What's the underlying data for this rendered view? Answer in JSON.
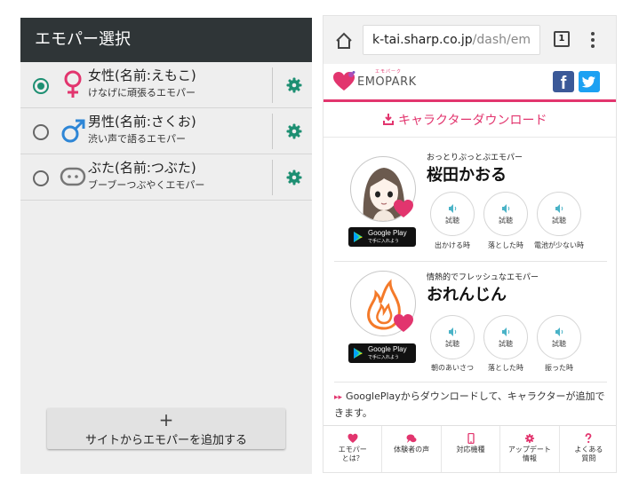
{
  "left": {
    "header_title": "エモパー選択",
    "items": [
      {
        "name": "女性(名前:えもこ)",
        "desc": "けなげに頑張るエモパー",
        "selected": true,
        "icon": "female-icon",
        "icon_color": "#e2356e"
      },
      {
        "name": "男性(名前:さくお)",
        "desc": "渋い声で語るエモパー",
        "selected": false,
        "icon": "male-icon",
        "icon_color": "#2e86d6"
      },
      {
        "name": "ぶた(名前:つぶた)",
        "desc": "ブーブーつぶやくエモパー",
        "selected": false,
        "icon": "pig-icon",
        "icon_color": "#777777"
      }
    ],
    "gear_icon": "gear-icon",
    "add_button_plus": "+",
    "add_button_label": "サイトからエモパーを追加する",
    "accent_color": "#1d8f72"
  },
  "browser": {
    "url_main": "k-tai.sharp.co.jp",
    "url_rest": "/dash/em",
    "tab_count": "1",
    "home_icon": "home-icon",
    "menu_icon": "overflow-menu-icon"
  },
  "site": {
    "logo_text": "EMOPARK",
    "logo_ruby": "エモパーク",
    "facebook_glyph": "f",
    "download_label": "キャラクターダウンロード",
    "accent_color": "#e2356e",
    "characters": [
      {
        "tagline": "おっとりぷっとぷエモパー",
        "name": "桜田かおる",
        "gplay_line1": "Google Play",
        "gplay_line2": "で手に入れよう",
        "voices": [
          {
            "button": "試聴",
            "label": "出かける時"
          },
          {
            "button": "試聴",
            "label": "落とした時"
          },
          {
            "button": "試聴",
            "label": "電池が少ない時"
          }
        ]
      },
      {
        "tagline": "情熱的でフレッシュなエモパー",
        "name": "おれんじん",
        "gplay_line1": "Google Play",
        "gplay_line2": "で手に入れよう",
        "voices": [
          {
            "button": "試聴",
            "label": "朝のあいさつ"
          },
          {
            "button": "試聴",
            "label": "落とした時"
          },
          {
            "button": "試聴",
            "label": "振った時"
          }
        ]
      }
    ],
    "note_arrow": "▸▸",
    "note_text": "GooglePlayからダウンロードして、キャラクターが追加できます。",
    "nav": [
      {
        "label": "エモパー\nとは？",
        "icon": "heart-icon"
      },
      {
        "label": "体験者の声",
        "icon": "chat-icon"
      },
      {
        "label": "対応機種",
        "icon": "phone-icon"
      },
      {
        "label": "アップデート\n情報",
        "icon": "gear-icon"
      },
      {
        "label": "よくある\n質問",
        "icon": "question-icon"
      }
    ]
  }
}
